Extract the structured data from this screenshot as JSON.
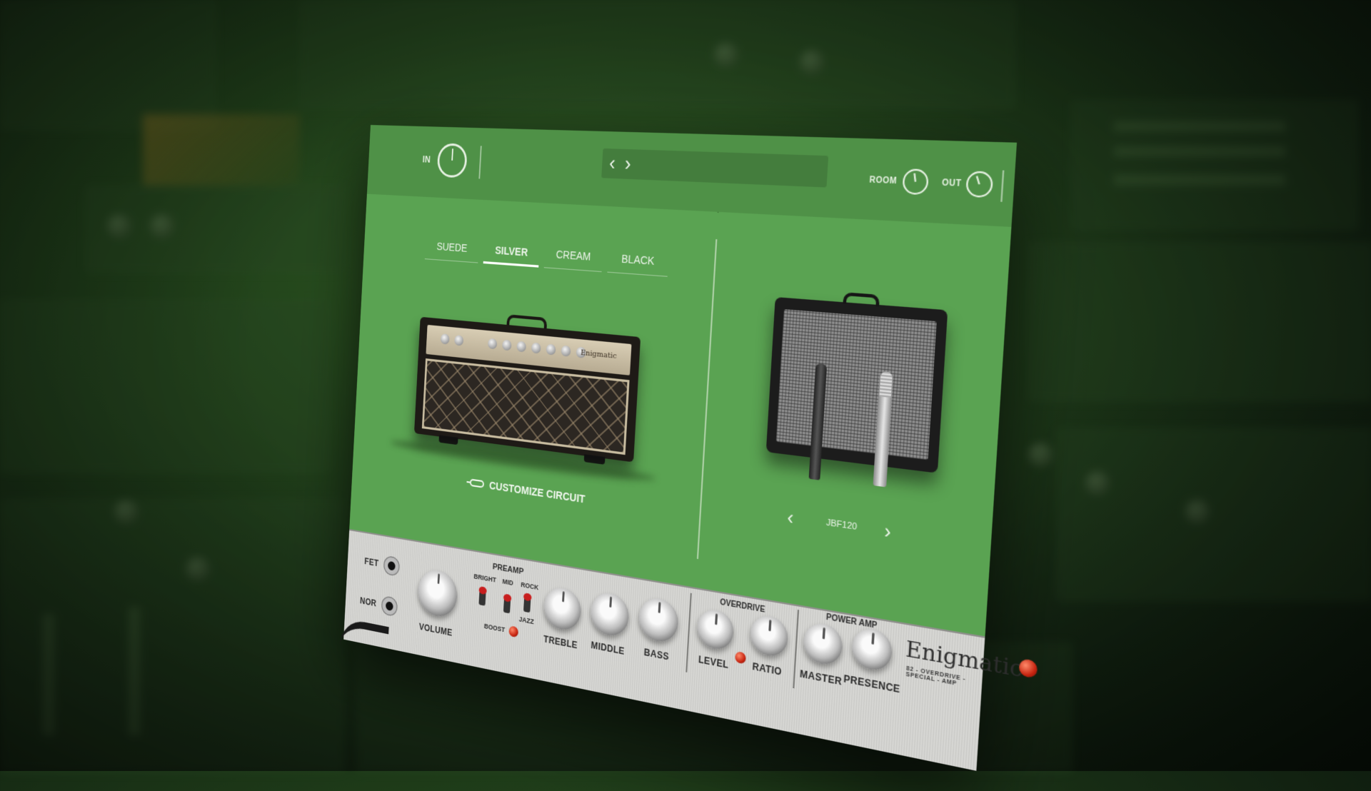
{
  "topbar": {
    "in_label": "IN",
    "room_label": "ROOM",
    "out_label": "OUT",
    "prev_icon": "chevron-left-icon",
    "next_icon": "chevron-right-icon"
  },
  "tabs": [
    {
      "label": "SUEDE",
      "active": false
    },
    {
      "label": "SILVER",
      "active": true
    },
    {
      "label": "CREAM",
      "active": false
    },
    {
      "label": "BLACK",
      "active": false
    }
  ],
  "amp": {
    "brand_mini": "Enigmatic",
    "customize_label": "CUSTOMIZE CIRCUIT"
  },
  "cabinet": {
    "name": "JBF120"
  },
  "panel": {
    "fet_label": "FET",
    "nor_label": "NOR",
    "volume_label": "VOLUME",
    "preamp_label": "PREAMP",
    "bright_label": "BRIGHT",
    "mid_label": "MID",
    "rock_label": "ROCK",
    "jazz_label": "JAZZ",
    "boost_label": "BOOST",
    "treble_label": "TREBLE",
    "middle_label": "MIDDLE",
    "bass_label": "BASS",
    "overdrive_label": "OVERDRIVE",
    "level_label": "LEVEL",
    "ratio_label": "RATIO",
    "power_amp_label": "POWER AMP",
    "master_label": "MASTER",
    "presence_label": "PRESENCE",
    "brand": "Enigmatic",
    "brand_sub": "82 - OVERDRIVE - SPECIAL - AMP"
  },
  "colors": {
    "plugin_green": "#5aa352",
    "topbar_green": "#4f9147",
    "led_red": "#c62410"
  }
}
